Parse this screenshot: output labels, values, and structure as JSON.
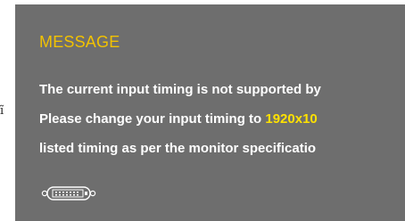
{
  "stray_char": "ĩ",
  "osd": {
    "title": "MESSAGE",
    "line1": "The current input timing is not supported by",
    "line2_prefix": "Please change your input timing to ",
    "line2_highlight": "1920x10",
    "line3": "listed timing as per the monitor specificatio",
    "icon": "dvi-connector-icon"
  },
  "colors": {
    "osd_background": "#6e6e6e",
    "title": "#f2c200",
    "text": "#ffffff",
    "highlight": "#ffe100"
  }
}
